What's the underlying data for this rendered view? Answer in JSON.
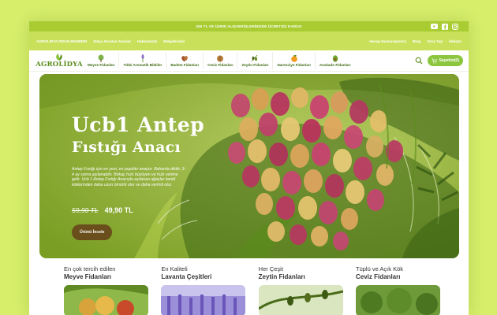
{
  "topbar": {
    "promo": "250 TL VE ÜZERİ ALIŞVERİŞLERİNİZDE ÜCRETSİZ KARGO",
    "social": [
      "youtube-icon",
      "facebook-icon",
      "instagram-icon"
    ]
  },
  "linkbar": {
    "brand": "AGROLİDYA FİDAN REHBERİ",
    "left": [
      "Sıkça Sorulan Sorular",
      "Hakkımızda",
      "Belgelerimiz"
    ],
    "right": [
      "Hesap Numaralarımız",
      "Blog",
      "Giriş Yap",
      "İletişim"
    ]
  },
  "logo": {
    "text": "AGROLİDYA"
  },
  "categories": [
    {
      "label": "Meyve Fidanları",
      "icon": "fruit-tree-icon"
    },
    {
      "label": "Tıbbi Aromatik Bitkiler",
      "icon": "lavender-icon"
    },
    {
      "label": "Badem Fidanları",
      "icon": "almond-icon"
    },
    {
      "label": "Ceviz Fidanları",
      "icon": "walnut-icon"
    },
    {
      "label": "Zeytin Fidanları",
      "icon": "olive-icon"
    },
    {
      "label": "Narenciye Fidanları",
      "icon": "orange-icon"
    },
    {
      "label": "Avokado Fidanları",
      "icon": "avocado-icon"
    }
  ],
  "cart": {
    "label": "Sepetim(0)"
  },
  "hero": {
    "title_line1": "Ucb1 Antep",
    "title_line2": "Fıstığı Anacı",
    "description": "Antep Fıstığı için en yeni, en popüler anaçtır. Bahar­da dikilir, 3-4 ay sonra aşılanabilir. Birkaç hızlı büyüyen ve hızlı verime gelir. Ucb 1 Antep Fıstığı Anacıyla aşılanan ağaçlar kendi köklerinden daha uzun ömürlü olur ve daha verimli olur.",
    "old_price": "59,90 TL",
    "new_price": "49,90 TL",
    "button": "Ürünü İncele"
  },
  "featured": [
    {
      "small": "En çok tercih edilen",
      "big": "Meyve Fidanları"
    },
    {
      "small": "En Kaliteli",
      "big": "Lavanta Çeşitleri"
    },
    {
      "small": "Her Çeşit",
      "big": "Zeytin Fidanları"
    },
    {
      "small": "Tüplü ve Açık Kök",
      "big": "Ceviz Fidanları"
    }
  ],
  "colors": {
    "page_bg": "#d6ee6a",
    "topbar": "#a9cc33",
    "linkbar": "#c9e05a",
    "hero_green": "#8aae2d",
    "button_brown": "#6a4e1b",
    "cart_green": "#8cc63f"
  }
}
